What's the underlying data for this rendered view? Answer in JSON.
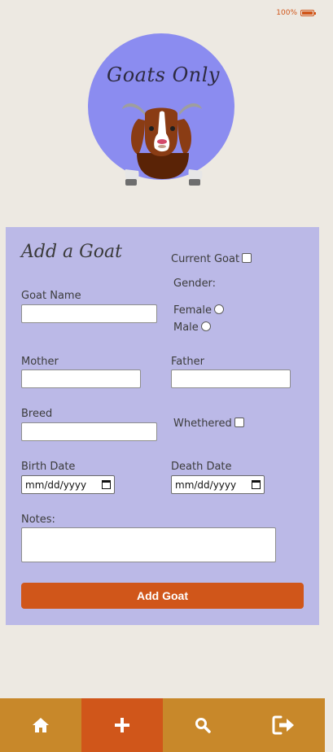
{
  "status": {
    "battery_text": "100%",
    "accent": "#d0561a"
  },
  "logo": {
    "title": "Goats Only",
    "circle_color": "#8b8cf0"
  },
  "form": {
    "heading": "Add a Goat",
    "current_goat_label": "Current Goat",
    "gender_label": "Gender:",
    "female_label": "Female",
    "male_label": "Male",
    "goat_name_label": "Goat Name",
    "mother_label": "Mother",
    "father_label": "Father",
    "breed_label": "Breed",
    "whethered_label": "Whethered",
    "birth_date_label": "Birth Date",
    "birth_date_value": "mm/dd/yyyy",
    "death_date_label": "Death Date",
    "death_date_value": "mm/dd/yyyy",
    "notes_label": "Notes:",
    "submit_label": "Add Goat"
  },
  "nav": {
    "items": [
      {
        "icon": "home-icon",
        "active": false
      },
      {
        "icon": "plus-icon",
        "active": true
      },
      {
        "icon": "search-icon",
        "active": false
      },
      {
        "icon": "logout-icon",
        "active": false
      }
    ],
    "colors": {
      "bar": "#c8882a",
      "active": "#d0561a"
    }
  }
}
